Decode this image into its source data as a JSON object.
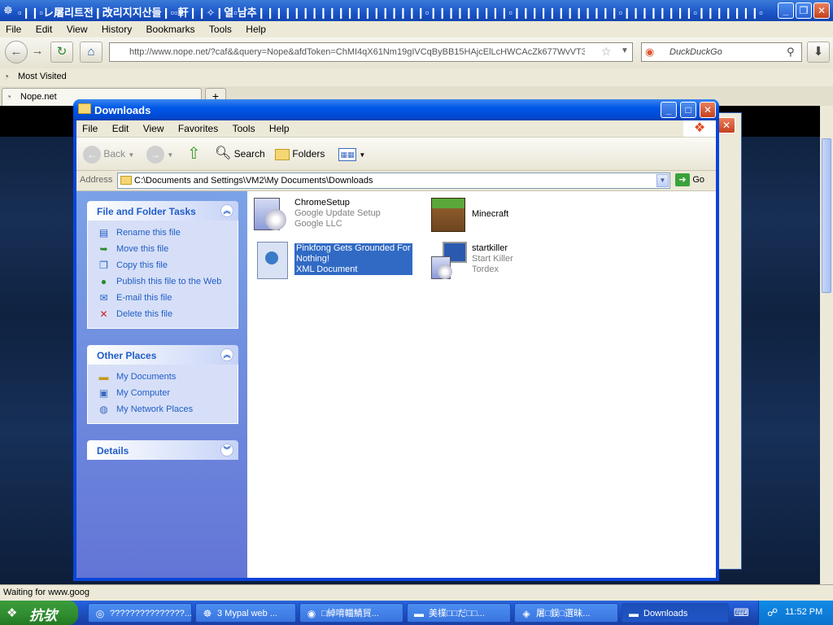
{
  "browser": {
    "title": "▫❙❙▫レ屠리트전❙改리지지산들❙▫▫軒❙❙✧❙열▫남추❙❙❙❙❙❙❙❙❙❙❙❙❙❙❙❙❙❙❙▫❙❙❙❙❙❙❙❙❙▫❙❙❙❙❙❙❙❙❙❙❙❙▫❙❙❙❙❙❙❙❙▫❙❙❙❙❙❙❙▫❙❙❙❙❙❙❙❙...",
    "menu": [
      "File",
      "Edit",
      "View",
      "History",
      "Bookmarks",
      "Tools",
      "Help"
    ],
    "url": "http://www.nope.net/?caf&&query=Nope&afdToken=ChMI4qX61Nm19gIVCqByBB15HAjcElLcHWCAcZk677WvVT3R9de",
    "search_placeholder": "DuckDuckGo",
    "bookmark": "Most Visited",
    "tab_label": "Nope.net",
    "new_tab": "+",
    "status": "Waiting for www.goog"
  },
  "explorer": {
    "title": "Downloads",
    "menu": [
      "File",
      "Edit",
      "View",
      "Favorites",
      "Tools",
      "Help"
    ],
    "toolbar": {
      "back": "Back",
      "search": "Search",
      "folders": "Folders"
    },
    "address_label": "Address",
    "address": "C:\\Documents and Settings\\VM2\\My Documents\\Downloads",
    "go": "Go",
    "panels": {
      "tasks": {
        "title": "File and Folder Tasks",
        "items": [
          "Rename this file",
          "Move this file",
          "Copy this file",
          "Publish this file to the Web",
          "E-mail this file",
          "Delete this file"
        ]
      },
      "places": {
        "title": "Other Places",
        "items": [
          "My Documents",
          "My Computer",
          "My Network Places"
        ]
      },
      "details": {
        "title": "Details"
      }
    },
    "files": [
      {
        "name": "ChromeSetup",
        "line2": "Google Update Setup",
        "line3": "Google LLC"
      },
      {
        "name": "Minecraft"
      },
      {
        "name": "Pinkfong Gets Grounded For",
        "name2": "Nothing!",
        "line3": "XML Document"
      },
      {
        "name": "startkiller",
        "line2": "Start Killer",
        "line3": "Tordex"
      }
    ]
  },
  "taskbar": {
    "start": "抗欤",
    "tasks": [
      "???????????????...",
      "3 Mypal web ...",
      "□綽唷輺鯖貿...",
      "美檏□□だ□□...",
      "屠□鋘□選昧...",
      "Downloads"
    ],
    "clock": "11:52 PM"
  },
  "colors": {
    "xp_blue": "#0a45d8",
    "selection": "#316ac5",
    "link": "#215dc6"
  }
}
